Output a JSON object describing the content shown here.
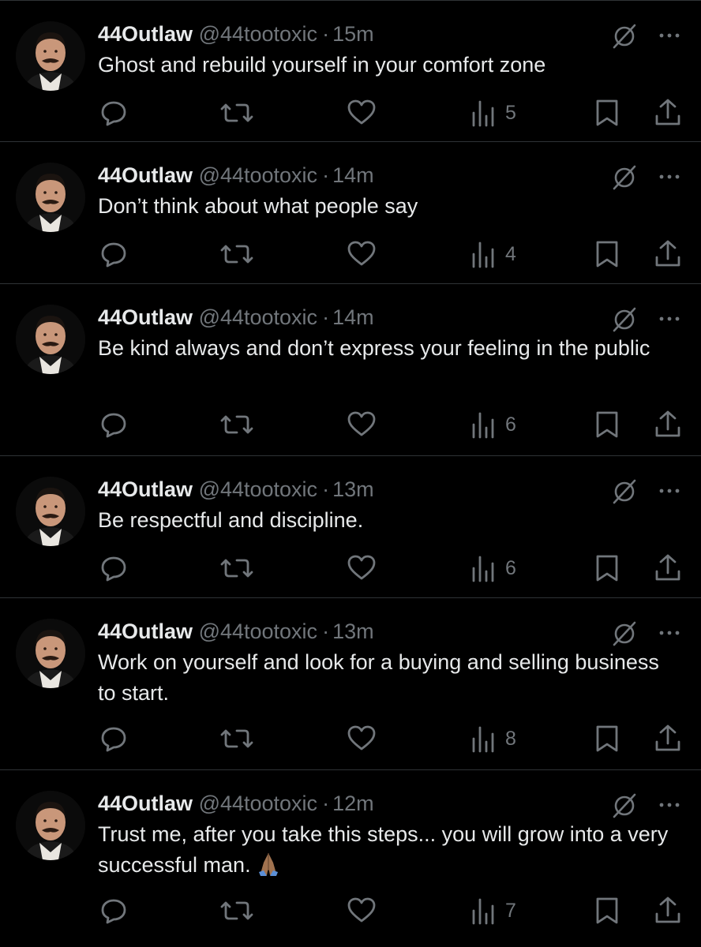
{
  "tweets": [
    {
      "name": "44Outlaw",
      "handle": "@44tootoxic",
      "separator": "·",
      "time": "15m",
      "text": "Ghost and rebuild yourself in your comfort zone",
      "views": "5"
    },
    {
      "name": "44Outlaw",
      "handle": "@44tootoxic",
      "separator": "·",
      "time": "14m",
      "text": "Don’t think about what people say",
      "views": "4"
    },
    {
      "name": "44Outlaw",
      "handle": "@44tootoxic",
      "separator": "·",
      "time": "14m",
      "text": "Be kind always and don’t express your feeling in the public",
      "views": "6"
    },
    {
      "name": "44Outlaw",
      "handle": "@44tootoxic",
      "separator": "·",
      "time": "13m",
      "text": "Be respectful and discipline.",
      "views": "6"
    },
    {
      "name": "44Outlaw",
      "handle": "@44tootoxic",
      "separator": "·",
      "time": "13m",
      "text": "Work on yourself and look for a buying and selling business to start.",
      "views": "8"
    },
    {
      "name": "44Outlaw",
      "handle": "@44tootoxic",
      "separator": "·",
      "time": "12m",
      "text": "Trust me, after you take this steps... you will grow into a very successful man.",
      "views": "7",
      "emoji": "folded-hands-emoji"
    }
  ],
  "icons": {
    "reply": "reply-icon",
    "retweet": "retweet-icon",
    "like": "heart-icon",
    "views": "views-bar-chart-icon",
    "bookmark": "bookmark-icon",
    "share": "share-icon",
    "grok": "grok-slash-icon",
    "more": "more-dots-icon"
  },
  "colors": {
    "background": "#000000",
    "text": "#e7e9ea",
    "secondary": "#71767b",
    "divider": "#2f3336"
  }
}
